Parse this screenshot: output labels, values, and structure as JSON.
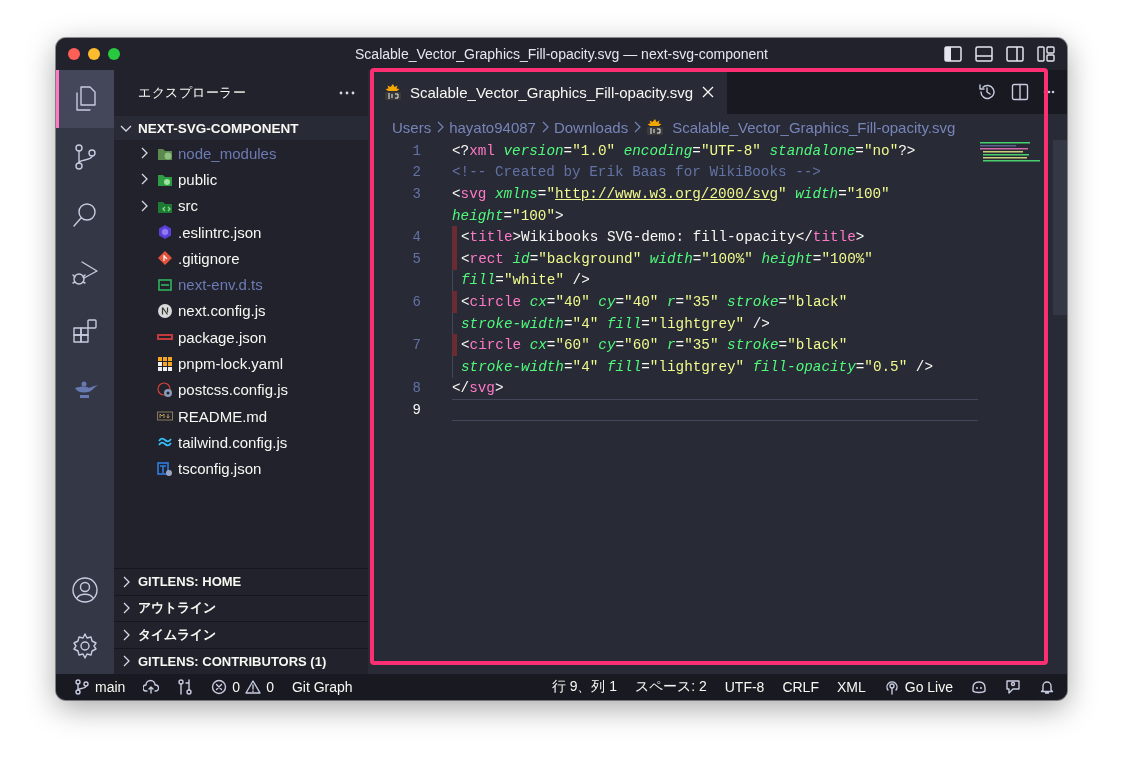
{
  "window": {
    "title": "Scalable_Vector_Graphics_Fill-opacity.svg — next-svg-component"
  },
  "activity_bar": {
    "items": [
      {
        "selected": true
      },
      {
        "selected": false
      },
      {
        "selected": false
      },
      {
        "selected": false
      },
      {
        "selected": false
      },
      {
        "selected": false
      }
    ]
  },
  "explorer": {
    "title": "エクスプローラー",
    "root": {
      "label": "NEXT-SVG-COMPONENT",
      "expanded": true,
      "children": [
        {
          "label": "node_modules",
          "kind": "folder",
          "expanded": false,
          "dimmed": true
        },
        {
          "label": "public",
          "kind": "folder",
          "expanded": false,
          "dimmed": false
        },
        {
          "label": "src",
          "kind": "folder",
          "expanded": false,
          "dimmed": false
        },
        {
          "label": ".eslintrc.json",
          "kind": "file",
          "dimmed": false
        },
        {
          "label": ".gitignore",
          "kind": "file",
          "dimmed": false
        },
        {
          "label": "next-env.d.ts",
          "kind": "file",
          "dimmed": true
        },
        {
          "label": "next.config.js",
          "kind": "file",
          "dimmed": false
        },
        {
          "label": "package.json",
          "kind": "file",
          "dimmed": false
        },
        {
          "label": "pnpm-lock.yaml",
          "kind": "file",
          "dimmed": false
        },
        {
          "label": "postcss.config.js",
          "kind": "file",
          "dimmed": false
        },
        {
          "label": "README.md",
          "kind": "file",
          "dimmed": false
        },
        {
          "label": "tailwind.config.js",
          "kind": "file",
          "dimmed": false
        },
        {
          "label": "tsconfig.json",
          "kind": "file",
          "dimmed": false
        }
      ]
    }
  },
  "panels": [
    {
      "label": "GITLENS: HOME",
      "expanded": false
    },
    {
      "label": "アウトライン",
      "expanded": false
    },
    {
      "label": "タイムライン",
      "expanded": false
    },
    {
      "label": "GITLENS: CONTRIBUTORS (1)",
      "expanded": false
    }
  ],
  "editor": {
    "tabs": [
      {
        "label": "Scalable_Vector_Graphics_Fill-opacity.svg",
        "selected": true
      }
    ],
    "breadcrumbs": [
      {
        "label": "Users",
        "kind": "folder"
      },
      {
        "label": "hayato94087",
        "kind": "folder"
      },
      {
        "label": "Downloads",
        "kind": "folder"
      },
      {
        "label": "Scalable_Vector_Graphics_Fill-opacity.svg",
        "kind": "file"
      }
    ],
    "lines": [
      {
        "number": "1",
        "flagged": false,
        "current": false,
        "rows": [
          {
            "segments": [
              {
                "kind": "punct",
                "text": "<?"
              },
              {
                "kind": "tag",
                "text": "xml"
              },
              {
                "kind": "attr",
                "text": " version"
              },
              {
                "kind": "punct",
                "text": "="
              },
              {
                "kind": "string",
                "text": "\"1.0\""
              },
              {
                "kind": "attr",
                "text": " encoding"
              },
              {
                "kind": "punct",
                "text": "="
              },
              {
                "kind": "string",
                "text": "\"UTF-8\""
              },
              {
                "kind": "attr",
                "text": " standalone"
              },
              {
                "kind": "punct",
                "text": "="
              },
              {
                "kind": "string",
                "text": "\"no\""
              },
              {
                "kind": "punct",
                "text": "?>"
              }
            ]
          }
        ]
      },
      {
        "number": "2",
        "flagged": false,
        "current": false,
        "rows": [
          {
            "segments": [
              {
                "kind": "comment",
                "text": "<!-- Created by Erik Baas for WikiBooks -->"
              }
            ]
          }
        ]
      },
      {
        "number": "3",
        "flagged": false,
        "current": false,
        "rows": [
          {
            "segments": [
              {
                "kind": "punct",
                "text": "<"
              },
              {
                "kind": "tag",
                "text": "svg"
              },
              {
                "kind": "attr",
                "text": " xmlns"
              },
              {
                "kind": "punct",
                "text": "="
              },
              {
                "kind": "string",
                "text": "\""
              },
              {
                "kind": "url",
                "text": "http://www.w3.org/2000/svg"
              },
              {
                "kind": "string",
                "text": "\""
              },
              {
                "kind": "attr",
                "text": " width"
              },
              {
                "kind": "punct",
                "text": "="
              },
              {
                "kind": "string",
                "text": "\"100\""
              }
            ]
          },
          {
            "segments": [
              {
                "kind": "attr",
                "text": "height"
              },
              {
                "kind": "punct",
                "text": "="
              },
              {
                "kind": "string",
                "text": "\"100\""
              },
              {
                "kind": "punct",
                "text": ">"
              }
            ]
          }
        ]
      },
      {
        "number": "4",
        "flagged": true,
        "current": false,
        "rows": [
          {
            "segments": [
              {
                "kind": "punct",
                "text": "<"
              },
              {
                "kind": "tag",
                "text": "title"
              },
              {
                "kind": "punct",
                "text": ">"
              },
              {
                "kind": "text",
                "text": "Wikibooks SVG-demo: fill-opacity"
              },
              {
                "kind": "punct",
                "text": "</"
              },
              {
                "kind": "tag",
                "text": "title"
              },
              {
                "kind": "punct",
                "text": ">"
              }
            ]
          }
        ]
      },
      {
        "number": "5",
        "flagged": true,
        "current": false,
        "rows": [
          {
            "segments": [
              {
                "kind": "punct",
                "text": "<"
              },
              {
                "kind": "tag",
                "text": "rect"
              },
              {
                "kind": "attr",
                "text": " id"
              },
              {
                "kind": "punct",
                "text": "="
              },
              {
                "kind": "string",
                "text": "\"background\""
              },
              {
                "kind": "attr",
                "text": " width"
              },
              {
                "kind": "punct",
                "text": "="
              },
              {
                "kind": "string",
                "text": "\"100%\""
              },
              {
                "kind": "attr",
                "text": " height"
              },
              {
                "kind": "punct",
                "text": "="
              },
              {
                "kind": "string",
                "text": "\"100%\""
              }
            ]
          },
          {
            "segments": [
              {
                "kind": "attr",
                "text": "fill"
              },
              {
                "kind": "punct",
                "text": "="
              },
              {
                "kind": "string",
                "text": "\"white\""
              },
              {
                "kind": "punct",
                "text": " />"
              }
            ]
          }
        ]
      },
      {
        "number": "6",
        "flagged": true,
        "current": false,
        "rows": [
          {
            "segments": [
              {
                "kind": "punct",
                "text": "<"
              },
              {
                "kind": "tag",
                "text": "circle"
              },
              {
                "kind": "attr",
                "text": " cx"
              },
              {
                "kind": "punct",
                "text": "="
              },
              {
                "kind": "string",
                "text": "\"40\""
              },
              {
                "kind": "attr",
                "text": " cy"
              },
              {
                "kind": "punct",
                "text": "="
              },
              {
                "kind": "string",
                "text": "\"40\""
              },
              {
                "kind": "attr",
                "text": " r"
              },
              {
                "kind": "punct",
                "text": "="
              },
              {
                "kind": "string",
                "text": "\"35\""
              },
              {
                "kind": "attr",
                "text": " stroke"
              },
              {
                "kind": "punct",
                "text": "="
              },
              {
                "kind": "string",
                "text": "\"black\""
              }
            ]
          },
          {
            "segments": [
              {
                "kind": "attr",
                "text": "stroke-width"
              },
              {
                "kind": "punct",
                "text": "="
              },
              {
                "kind": "string",
                "text": "\"4\""
              },
              {
                "kind": "attr",
                "text": " fill"
              },
              {
                "kind": "punct",
                "text": "="
              },
              {
                "kind": "string",
                "text": "\"lightgrey\""
              },
              {
                "kind": "punct",
                "text": " />"
              }
            ]
          }
        ]
      },
      {
        "number": "7",
        "flagged": true,
        "current": false,
        "rows": [
          {
            "segments": [
              {
                "kind": "punct",
                "text": "<"
              },
              {
                "kind": "tag",
                "text": "circle"
              },
              {
                "kind": "attr",
                "text": " cx"
              },
              {
                "kind": "punct",
                "text": "="
              },
              {
                "kind": "string",
                "text": "\"60\""
              },
              {
                "kind": "attr",
                "text": " cy"
              },
              {
                "kind": "punct",
                "text": "="
              },
              {
                "kind": "string",
                "text": "\"60\""
              },
              {
                "kind": "attr",
                "text": " r"
              },
              {
                "kind": "punct",
                "text": "="
              },
              {
                "kind": "string",
                "text": "\"35\""
              },
              {
                "kind": "attr",
                "text": " stroke"
              },
              {
                "kind": "punct",
                "text": "="
              },
              {
                "kind": "string",
                "text": "\"black\""
              }
            ]
          },
          {
            "segments": [
              {
                "kind": "attr",
                "text": "stroke-width"
              },
              {
                "kind": "punct",
                "text": "="
              },
              {
                "kind": "string",
                "text": "\"4\""
              },
              {
                "kind": "attr",
                "text": " fill"
              },
              {
                "kind": "punct",
                "text": "="
              },
              {
                "kind": "string",
                "text": "\"lightgrey\""
              },
              {
                "kind": "attr",
                "text": " fill-opacity"
              },
              {
                "kind": "punct",
                "text": "="
              },
              {
                "kind": "string",
                "text": "\"0.5\""
              },
              {
                "kind": "punct",
                "text": " />"
              }
            ]
          }
        ]
      },
      {
        "number": "8",
        "flagged": false,
        "current": false,
        "rows": [
          {
            "segments": [
              {
                "kind": "punct",
                "text": "</"
              },
              {
                "kind": "tag",
                "text": "svg"
              },
              {
                "kind": "punct",
                "text": ">"
              }
            ]
          }
        ]
      },
      {
        "number": "9",
        "flagged": false,
        "current": true
      }
    ]
  },
  "status_bar": {
    "left": [
      {
        "kind": "branch",
        "text": "main"
      },
      {
        "kind": "sync"
      },
      {
        "kind": "compare"
      },
      {
        "kind": "problems",
        "errors": "0",
        "warnings": "0"
      },
      {
        "kind": "text",
        "text": "Git Graph"
      }
    ],
    "right": [
      {
        "kind": "text",
        "text": "行 9、列 1"
      },
      {
        "kind": "text",
        "text": "スペース: 2"
      },
      {
        "kind": "text",
        "text": "UTF-8"
      },
      {
        "kind": "text",
        "text": "CRLF"
      },
      {
        "kind": "text",
        "text": "XML"
      },
      {
        "kind": "live",
        "text": "Go Live"
      },
      {
        "kind": "copilot"
      },
      {
        "kind": "feedback"
      },
      {
        "kind": "bell"
      }
    ]
  }
}
